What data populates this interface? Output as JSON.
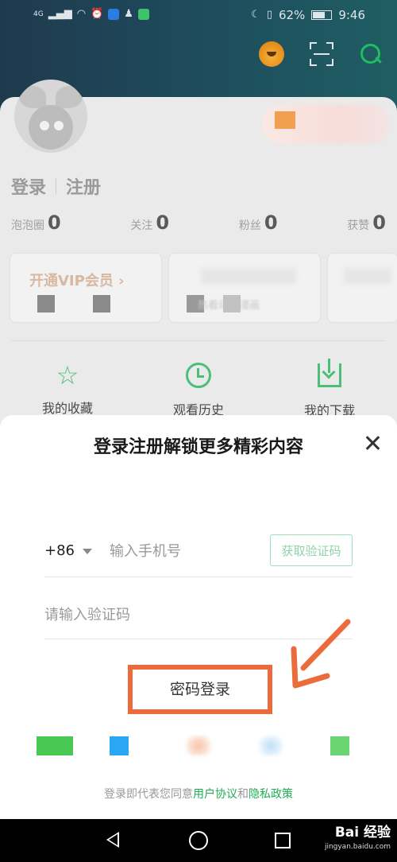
{
  "status_bar": {
    "signal": "4G",
    "battery": "62%",
    "time": "9:46"
  },
  "profile": {
    "login": "登录",
    "register": "注册",
    "stats": [
      {
        "label": "泡泡圈",
        "value": "0"
      },
      {
        "label": "关注",
        "value": "0"
      },
      {
        "label": "粉丝",
        "value": "0"
      },
      {
        "label": "获赞",
        "value": "0"
      }
    ],
    "vip_card_title": "开通VIP会员 ›",
    "vip_card2_sub": "热看动画漫画",
    "quick_actions": [
      {
        "label": "我的收藏",
        "icon": "star-icon"
      },
      {
        "label": "观看历史",
        "icon": "clock-icon"
      },
      {
        "label": "我的下载",
        "icon": "download-icon"
      }
    ]
  },
  "sheet": {
    "title": "登录注册解锁更多精彩内容",
    "country_code": "+86",
    "phone_placeholder": "输入手机号",
    "get_code": "获取验证码",
    "code_placeholder": "请输入验证码",
    "password_login": "密码登录",
    "agreement_prefix": "登录即代表您同意",
    "user_agreement": "用户协议",
    "and": "和",
    "privacy_policy": "隐私政策"
  },
  "watermark": {
    "brand": "Bai 经验",
    "url": "jingyan.baidu.com"
  },
  "colors": {
    "accent_green": "#1fad55",
    "highlight_orange": "#ec6b3c"
  }
}
